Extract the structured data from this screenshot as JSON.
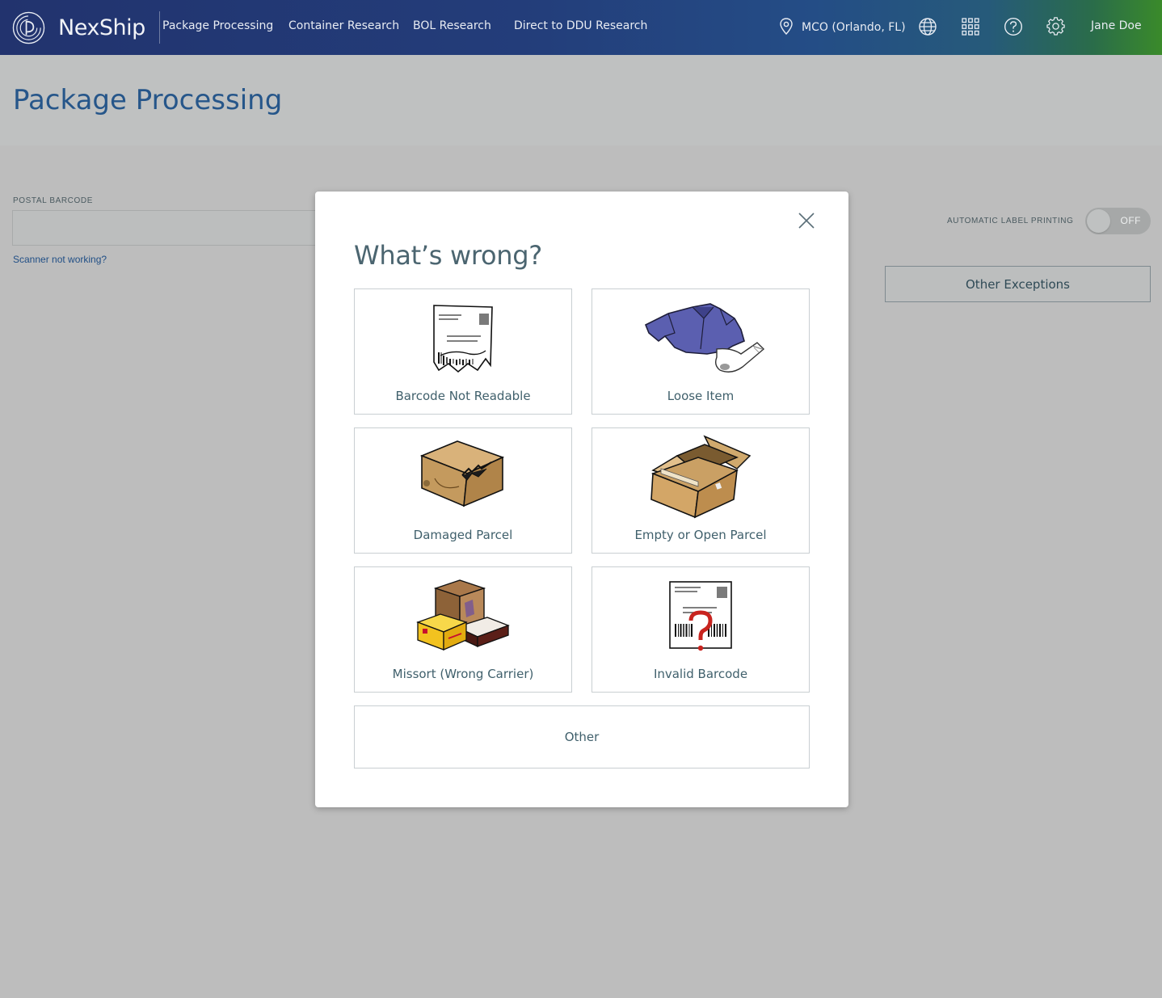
{
  "app": {
    "brand_name": "NexShip",
    "nav": [
      {
        "label": "Package Processing"
      },
      {
        "label": "Container Research"
      },
      {
        "label": "BOL Research"
      },
      {
        "label": "Direct to DDU Research"
      }
    ],
    "location": "MCO (Orlando, FL)",
    "user_name": "Jane Doe",
    "icons": [
      "location-pin-icon",
      "globe-icon",
      "app-grid-icon",
      "help-icon",
      "settings-gear-icon"
    ]
  },
  "page": {
    "title": "Package Processing",
    "postal_barcode_label": "POSTAL BARCODE",
    "postal_barcode_value": "",
    "scanner_link": "Scanner not working?",
    "auto_label_printing_label": "AUTOMATIC LABEL PRINTING",
    "auto_label_printing_state": "OFF",
    "other_exceptions_label": "Other Exceptions"
  },
  "modal": {
    "title": "What’s wrong?",
    "options": [
      {
        "label": "Barcode Not Readable",
        "icon": "torn-label-icon"
      },
      {
        "label": "Loose Item",
        "icon": "loose-clothing-icon"
      },
      {
        "label": "Damaged Parcel",
        "icon": "damaged-box-icon"
      },
      {
        "label": "Empty or Open Parcel",
        "icon": "open-box-icon"
      },
      {
        "label": "Missort (Wrong Carrier)",
        "icon": "stacked-boxes-icon"
      },
      {
        "label": "Invalid Barcode",
        "icon": "barcode-question-icon"
      }
    ],
    "other_label": "Other"
  },
  "colors": {
    "overlay_bg": "#bdbdbd",
    "title_blue": "#26568a",
    "nav_start": "#22336e",
    "nav_end": "#3a8a2a"
  }
}
